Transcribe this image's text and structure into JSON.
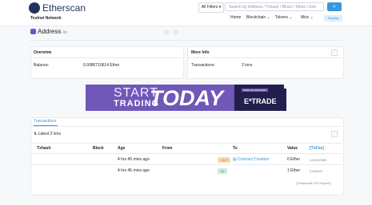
{
  "header": {
    "brand": "Etherscan",
    "network": "Testnet Network",
    "filter_label": "All Filters",
    "search_placeholder": "Search by Address / Txhash / Block / Token / Ens",
    "nav": [
      "Home",
      "Blockchain",
      "Tokens",
      "Misc"
    ],
    "nav_button": "Sepolia"
  },
  "address": {
    "title": "Address",
    "value": "0x"
  },
  "overview": {
    "title": "Overview",
    "balance_label": "Balance:",
    "balance_value": "0.0086710614 Ether"
  },
  "more_info": {
    "title": "More Info",
    "tx_label": "Transactions:",
    "tx_value": "2 txns"
  },
  "ad": {
    "start": "START",
    "trading": "TRADING",
    "today": "TODAY",
    "small": "OPEN AN ACCOUNT",
    "brand": "E*TRADE",
    "close": "x"
  },
  "transactions": {
    "tab": "Transactions",
    "summary": "Latest 2 txns",
    "columns": [
      "Txhash",
      "Block",
      "Age",
      "From",
      "",
      "To",
      "Value",
      "[TxFee]"
    ],
    "rows": [
      {
        "age": "4 hrs 45 mins ago",
        "direction": "OUT",
        "to": "Contract Creation",
        "value": "0 Ether",
        "fee": "0.00152985"
      },
      {
        "age": "4 hrs 45 mins ago",
        "direction": "IN",
        "to": "",
        "value": "1 Ether",
        "fee": "0.000021"
      }
    ],
    "download": "[ Download CSV Export ]"
  },
  "colors": {
    "accent": "#3498db",
    "brand": "#21325b",
    "ad_purple": "#6f58b8",
    "out_badge": "#f4d9b2",
    "in_badge": "#cdebd6"
  }
}
